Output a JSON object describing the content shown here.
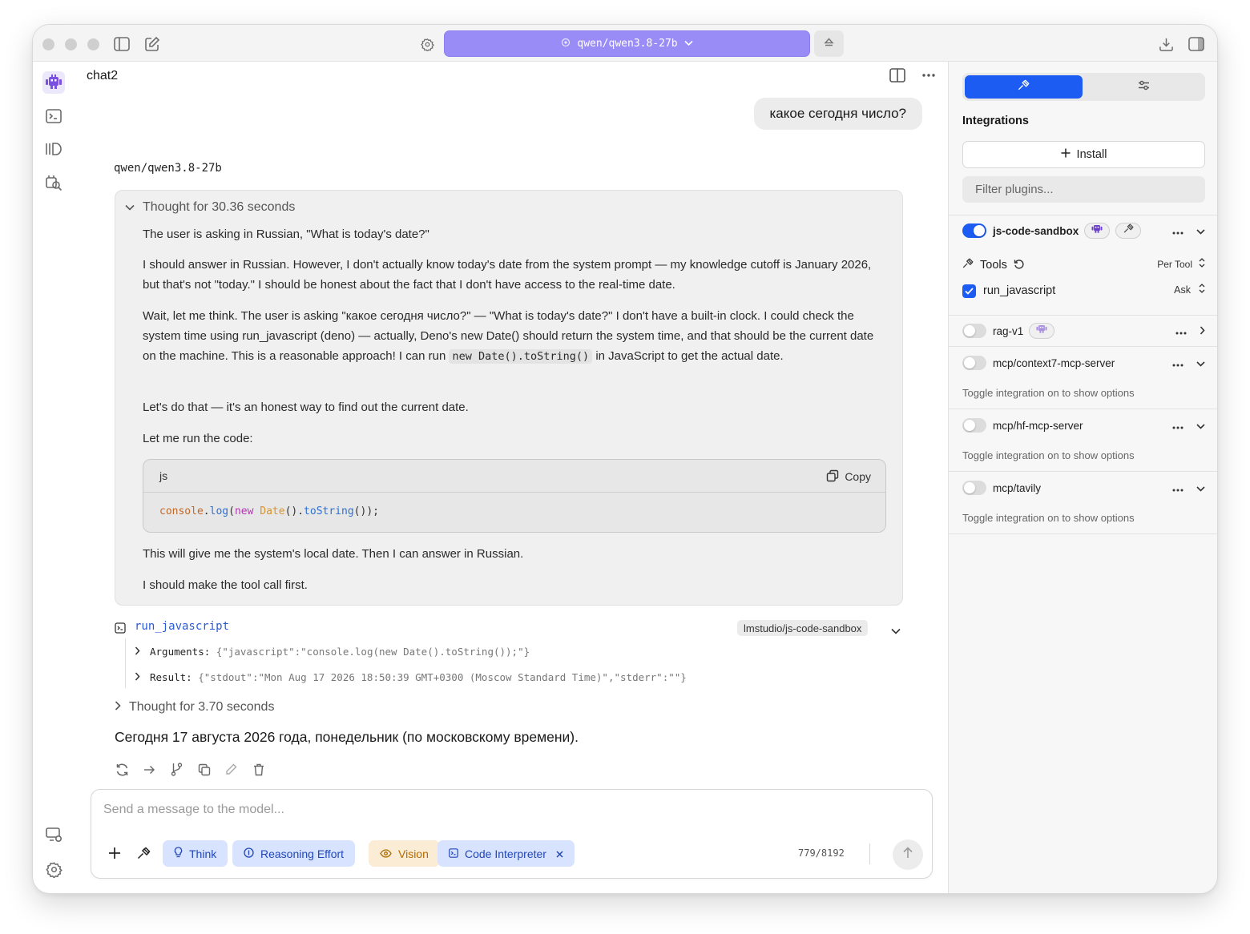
{
  "titlebar": {
    "model": "qwen/qwen3.8-27b"
  },
  "chat": {
    "title": "chat2",
    "user_message": "какое сегодня число?",
    "model_name": "qwen/qwen3.8-27b",
    "thought": {
      "header": "Thought for 30.36 seconds",
      "p1": "The user is asking in Russian, \"What is today's date?\"",
      "p2": "I should answer in Russian. However, I don't actually know today's date from the system prompt — my knowledge cutoff is January 2026, but that's not \"today.\" I should be honest about the fact that I don't have access to the real-time date.",
      "p3a": "Wait, let me think. The user is asking \"какое сегодня число?\" — \"What is today's date?\" I don't have a built-in clock. I could check the system time using run_javascript (deno) — actually, Deno's new Date() should return the system time, and that should be the current date on the machine. This is a reasonable approach! I can run ",
      "p3code": "new Date().toString()",
      "p3b": " in JavaScript to get the actual date.",
      "p4": "Let's do that — it's an honest way to find out the current date.",
      "p5": "Let me run the code:",
      "code_lang": "js",
      "copy_label": "Copy",
      "code_tokens": {
        "t1": "console",
        "t2": ".",
        "t3": "log",
        "t4": "(",
        "t5": "new",
        "t6": " ",
        "t7": "Date",
        "t8": "().",
        "t9": "toString",
        "t10": "());"
      },
      "p6": "This will give me the system's local date. Then I can answer in Russian.",
      "p7": "I should make the tool call first."
    },
    "tool_call": {
      "name": "run_javascript",
      "source": "lmstudio/js-code-sandbox",
      "arguments_label": "Arguments:",
      "arguments_value": "{\"javascript\":\"console.log(new Date().toString());\"}",
      "result_label": "Result:",
      "result_value": "{\"stdout\":\"Mon Aug 17 2026 18:50:39 GMT+0300 (Moscow Standard Time)\",\"stderr\":\"\"}"
    },
    "thought2": "Thought for 3.70 seconds",
    "answer": "Сегодня 17 августа 2026 года, понедельник (по московскому времени)."
  },
  "composer": {
    "placeholder": "Send a message to the model...",
    "chips": {
      "think": "Think",
      "reasoning": "Reasoning Effort",
      "vision": "Vision",
      "code": "Code Interpreter"
    },
    "counter": "779/8192"
  },
  "right_panel": {
    "heading": "Integrations",
    "install_label": "Install",
    "filter_placeholder": "Filter plugins...",
    "plugins": [
      {
        "name": "js-code-sandbox",
        "enabled": true
      },
      {
        "name": "rag-v1",
        "enabled": false
      },
      {
        "name": "mcp/context7-mcp-server",
        "enabled": false,
        "note": "Toggle integration on to show options"
      },
      {
        "name": "mcp/hf-mcp-server",
        "enabled": false,
        "note": "Toggle integration on to show options"
      },
      {
        "name": "mcp/tavily",
        "enabled": false,
        "note": "Toggle integration on to show options"
      }
    ],
    "tools_label": "Tools",
    "per_tool_label": "Per Tool",
    "run_tool_name": "run_javascript",
    "ask_label": "Ask"
  },
  "colors": {
    "accent": "#1d5cf2",
    "model_pill": "#9a8cf7",
    "tool_link": "#2a5bd7",
    "vision_chip": "#b26b00"
  }
}
